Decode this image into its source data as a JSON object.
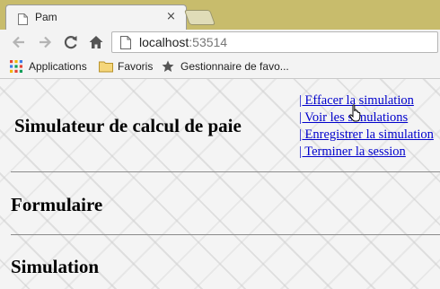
{
  "browser": {
    "tab": {
      "title": "Pam",
      "close_symbol": "×",
      "favicon": "page-icon"
    },
    "address_bar": {
      "host": "localhost",
      "port": ":53514"
    },
    "nav_icons": [
      "back-arrow-icon",
      "forward-arrow-icon",
      "reload-icon",
      "home-icon"
    ],
    "bookmarks": [
      {
        "label": "Applications",
        "icon": "apps-grid-icon"
      },
      {
        "label": "Favoris",
        "icon": "folder-icon"
      },
      {
        "label": "Gestionnaire de favo...",
        "icon": "star-icon"
      }
    ]
  },
  "page": {
    "title": "Simulateur de calcul de paie",
    "links": [
      "| Effacer la simulation",
      "| Voir les simulations",
      "| Enregistrer la simulation",
      "| Terminer la session"
    ],
    "sections": [
      "Formulaire",
      "Simulation"
    ]
  },
  "colors": {
    "chrome_frame": "#c8bc6c",
    "toolbar": "#f3f3f3",
    "link": "#0000cc",
    "page_background": "#f4f4f4"
  }
}
